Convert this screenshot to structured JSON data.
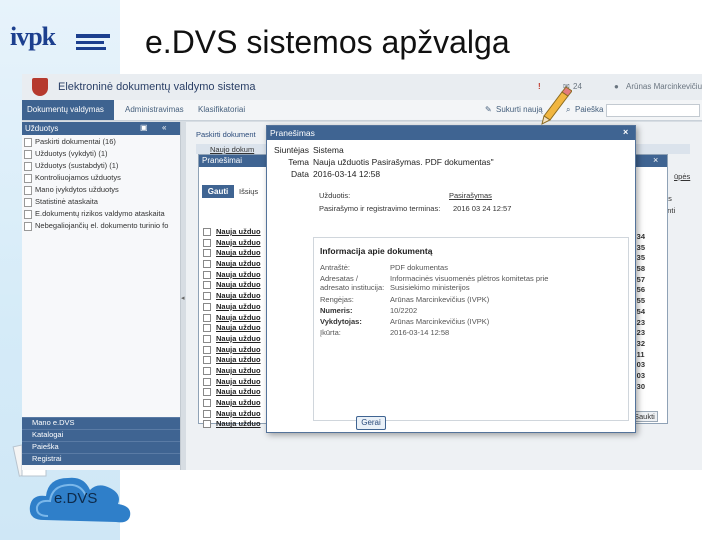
{
  "slide": {
    "title": "e.DVS  sistemos apžvalga",
    "logo_text": "ivpk",
    "cloud_label": "e.DVS"
  },
  "app": {
    "title": "Elektroninė dokumentų valdymo sistema",
    "mail_count": "24",
    "user": "Arūnas Marcinkevičiu",
    "search_label": "Paieška",
    "create_label": "Sukurti naują"
  },
  "nav": {
    "tabs": [
      "Dokumentų valdymas",
      "Administravimas",
      "Klasifikatoriai"
    ]
  },
  "sidebar": {
    "header": "Užduotys",
    "items": [
      "Paskirti dokumentai (16)",
      "Užduotys (vykdyti) (1)",
      "Užduotys (sustabdyti) (1)",
      "Kontroliuojamos užduotys",
      "Mano įvykdytos užduotys",
      "Statistinė ataskaita",
      "E.dokumentų rizikos valdymo ataskaita",
      "Nebegaliojančių el. dokumento turinio fo"
    ],
    "bottom": [
      "Mano e.DVS",
      "Katalogai",
      "Paieška",
      "Registrai"
    ]
  },
  "background": {
    "list_title": "Paskirti dokument",
    "sub_title": "Naujo dokum",
    "dialog2_title": "Pranešimai",
    "tabs": [
      "Gauti",
      "Išsiųs"
    ],
    "row_label": "Nauja užduo",
    "times": [
      "6:34",
      "4:35",
      "4:35",
      "2:58",
      "2:57",
      "2:56",
      "2:55",
      "2:54",
      "9:23",
      "9:23",
      "2:32",
      "3:11",
      "2:03",
      "2:03",
      "1:30"
    ],
    "right_labels": [
      "ūpės",
      "nkus",
      "aižinti",
      "Saukti"
    ]
  },
  "dialog": {
    "title": "Pranešimas",
    "sender_label": "Siuntėjas",
    "sender": "Sistema",
    "subject_label": "Tema",
    "subject": "Nauja užduotis Pasirašymas. PDF dokumentas\"",
    "date_label": "Data",
    "date": "2016-03-14 12:58",
    "task_label": "Užduotis:",
    "task": "Pasirašymas",
    "deadline_label": "Pasirašymo ir registravimo terminas:",
    "deadline": "2016 03 24 12:57",
    "info_header": "Informacija apie dokumentą",
    "fields": [
      {
        "k": "Antraštė:",
        "v": "PDF dokumentas"
      },
      {
        "k": "Adresatas / adresato institucija:",
        "v": "Informacinės visuomenės plėtros komitetas prie Susisiekimo ministerijos"
      },
      {
        "k": "Rengėjas:",
        "v": "Arūnas Marcinkevičius (IVPK)"
      },
      {
        "k": "Numeris:",
        "v": "10/2202"
      },
      {
        "k": "Vykdytojas:",
        "v": "Arūnas Marcinkevičius (IVPK)"
      },
      {
        "k": "Įkūrta:",
        "v": "2016-03-14 12:58"
      }
    ],
    "ok_label": "Gerai"
  }
}
